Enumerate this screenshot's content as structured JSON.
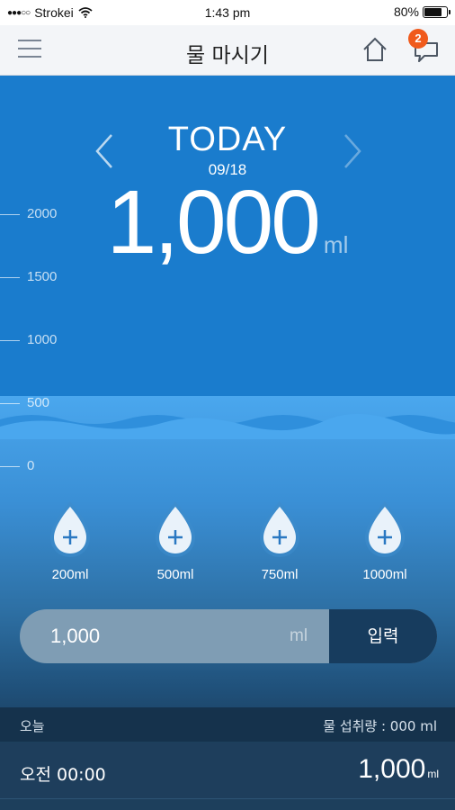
{
  "status_bar": {
    "carrier": "Strokei",
    "signal_dots": "●●●○○",
    "time": "1:43 pm",
    "battery": "80%",
    "battery_level": 0.8
  },
  "nav": {
    "title": "물 마시기",
    "notification_count": "2"
  },
  "hero": {
    "day_label": "TODAY",
    "date": "09/18",
    "amount": "1,000",
    "unit": "ml",
    "scale_labels": [
      "2000",
      "1500",
      "1000",
      "500",
      "0"
    ]
  },
  "quick_add": [
    {
      "label": "200ml"
    },
    {
      "label": "500ml"
    },
    {
      "label": "750ml"
    },
    {
      "label": "1000ml"
    }
  ],
  "input": {
    "value": "1,000",
    "unit": "ml",
    "submit_label": "입력"
  },
  "summary": {
    "left": "오늘",
    "right": "물 섭취량 : 000 ml"
  },
  "records": [
    {
      "time": "오전 00:00",
      "amount": "1,000",
      "unit": "ml"
    }
  ],
  "colors": {
    "sky": "#1a7ccd",
    "water": "#4aa7ee",
    "deep": "#1d3f5c",
    "badge": "#f05a1c",
    "submit": "#173c5e"
  }
}
